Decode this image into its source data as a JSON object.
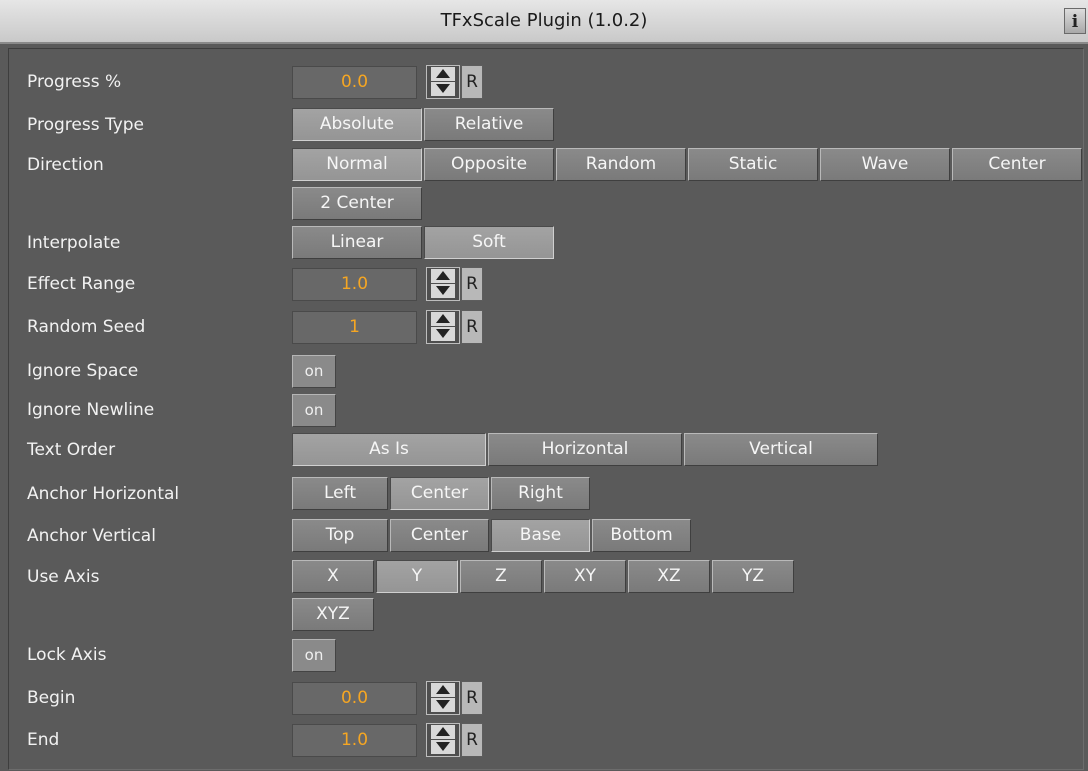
{
  "window": {
    "title": "TFxScale Plugin (1.0.2)",
    "info_glyph": "i"
  },
  "labels": {
    "progress": "Progress %",
    "progress_type": "Progress Type",
    "direction": "Direction",
    "interpolate": "Interpolate",
    "effect_range": "Effect Range",
    "random_seed": "Random Seed",
    "ignore_space": "Ignore Space",
    "ignore_newline": "Ignore Newline",
    "text_order": "Text Order",
    "anchor_horizontal": "Anchor Horizontal",
    "anchor_vertical": "Anchor Vertical",
    "use_axis": "Use Axis",
    "lock_axis": "Lock Axis",
    "begin": "Begin",
    "end": "End"
  },
  "values": {
    "progress": "0.0",
    "effect_range": "1.0",
    "random_seed": "1",
    "begin": "0.0",
    "end": "1.0"
  },
  "reset_label": "R",
  "toggle_label": "on",
  "progress_type": {
    "options": [
      "Absolute",
      "Relative"
    ],
    "selected": "Absolute"
  },
  "direction": {
    "options": [
      "Normal",
      "Opposite",
      "Random",
      "Static",
      "Wave",
      "Center",
      "2 Center"
    ],
    "selected": "Normal"
  },
  "interpolate": {
    "options": [
      "Linear",
      "Soft"
    ],
    "selected": "Soft"
  },
  "text_order": {
    "options": [
      "As Is",
      "Horizontal",
      "Vertical"
    ],
    "selected": "As Is"
  },
  "anchor_horizontal": {
    "options": [
      "Left",
      "Center",
      "Right"
    ],
    "selected": "Center"
  },
  "anchor_vertical": {
    "options": [
      "Top",
      "Center",
      "Base",
      "Bottom"
    ],
    "selected": "Base"
  },
  "use_axis": {
    "options": [
      "X",
      "Y",
      "Z",
      "XY",
      "XZ",
      "YZ",
      "XYZ"
    ],
    "selected": "Y"
  },
  "colors": {
    "value_text": "#f5a623",
    "panel_bg": "#5a5a5a",
    "title_bg": "#d8d8d8"
  }
}
